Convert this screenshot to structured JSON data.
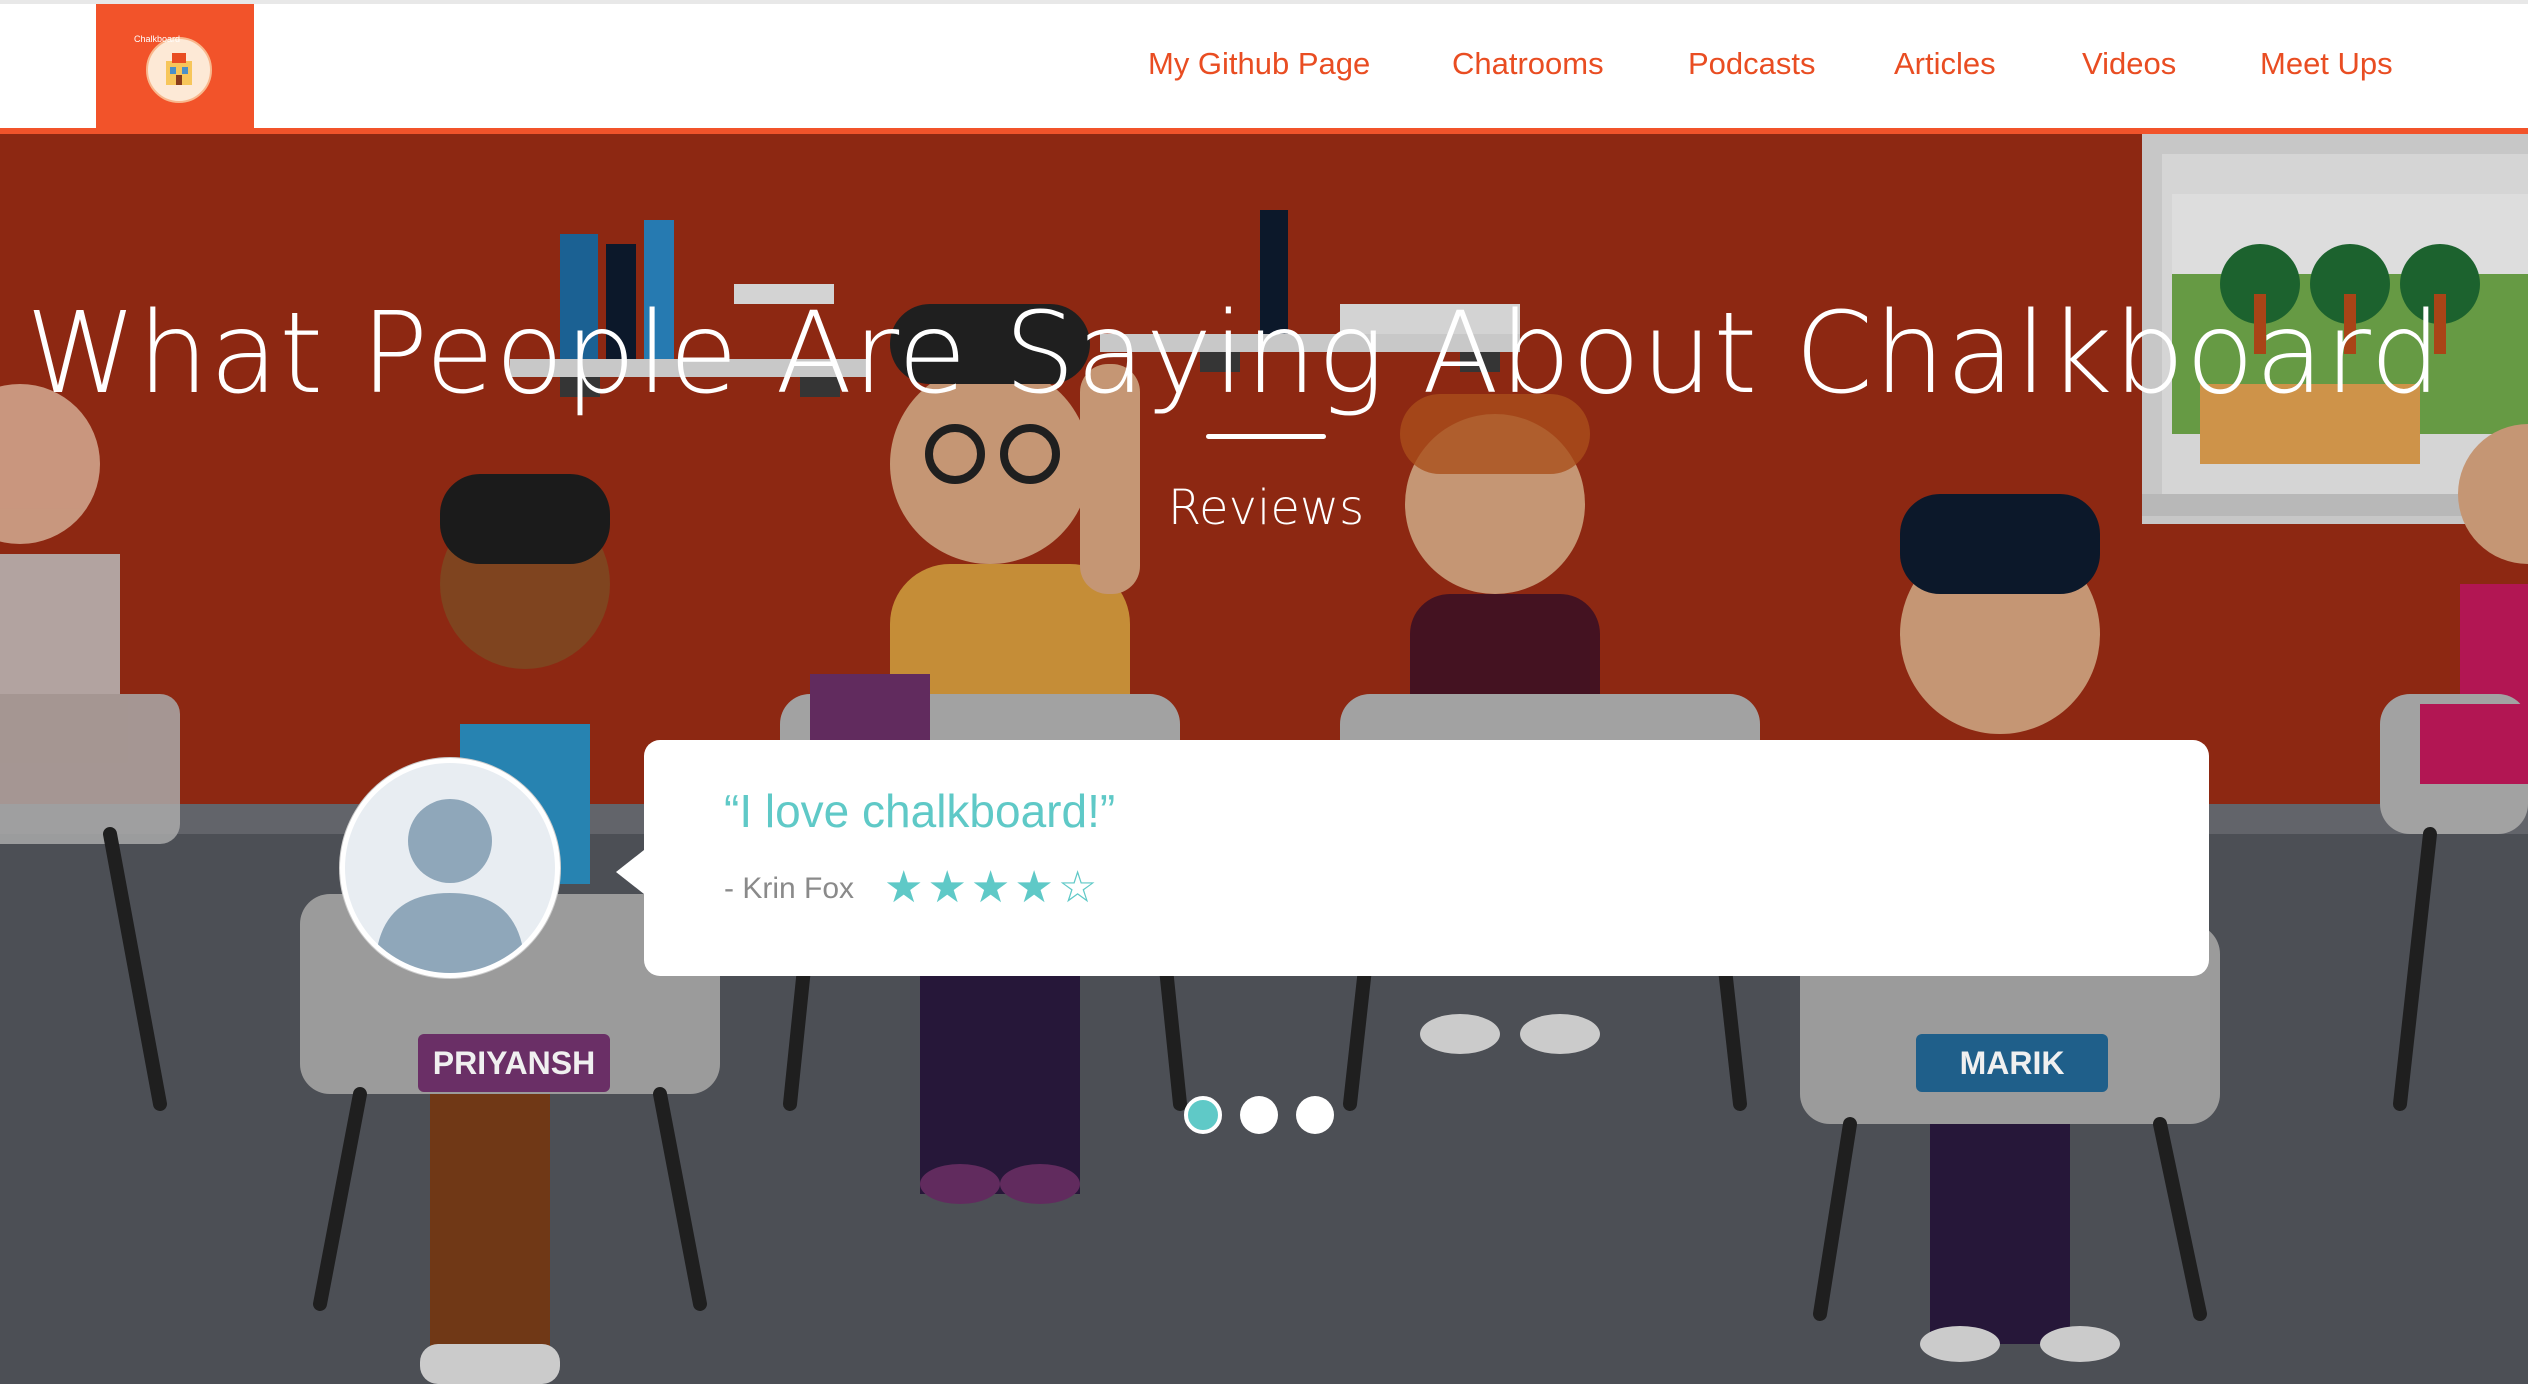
{
  "header": {
    "logo_text": "Chalkboard",
    "nav": [
      "My Github Page",
      "Chatrooms",
      "Podcasts",
      "Articles",
      "Videos",
      "Meet Ups"
    ]
  },
  "hero": {
    "title": "What People Are Saying About Chalkboard",
    "subtitle": "Reviews",
    "name_tags": [
      "PRIYANSH",
      "MARIK"
    ]
  },
  "review": {
    "quote": "“I love chalkboard!”",
    "author": "- Krin Fox",
    "rating": 4,
    "max_rating": 5
  },
  "carousel": {
    "slides": 3,
    "active": 0
  },
  "colors": {
    "brand": "#f2532a",
    "accent": "#5fc9c7",
    "hero_wall": "#9a2c14",
    "floor": "#53565d"
  }
}
